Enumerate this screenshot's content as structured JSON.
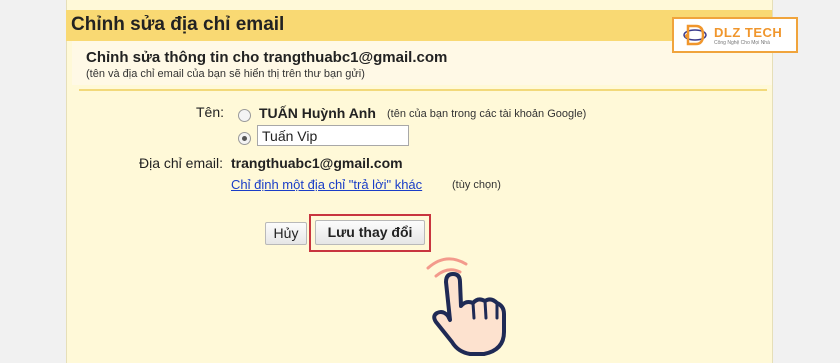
{
  "dialog": {
    "title": "Chỉnh sửa địa chỉ email",
    "subheading": "Chỉnh sửa thông tin cho trangthuabc1@gmail.com",
    "subnote": "(tên và địa chỉ email của bạn sẽ hiển thị trên thư bạn gửi)"
  },
  "name_field": {
    "label": "Tên:",
    "option_google_name": "TUẤN Huỳnh Anh",
    "option_google_note": "(tên của bạn trong các tài khoản Google)",
    "custom_value": "Tuấn Vip",
    "selected_option": "custom"
  },
  "email_field": {
    "label": "Địa chỉ email:",
    "value": "trangthuabc1@gmail.com",
    "reply_link": "Chỉ định một địa chỉ \"trả lời\" khác",
    "reply_note": "(tùy chọn)"
  },
  "buttons": {
    "cancel": "Hủy",
    "save": "Lưu thay đổi"
  },
  "watermark": {
    "brand": "DLZ TECH",
    "tagline": "Công Nghệ Cho Mọi Nhà",
    "color": "#f0962c"
  },
  "colors": {
    "title_bar": "#f9d973",
    "panel": "#fff9d8",
    "highlight": "#c8353f",
    "link": "#1a3dc7"
  }
}
